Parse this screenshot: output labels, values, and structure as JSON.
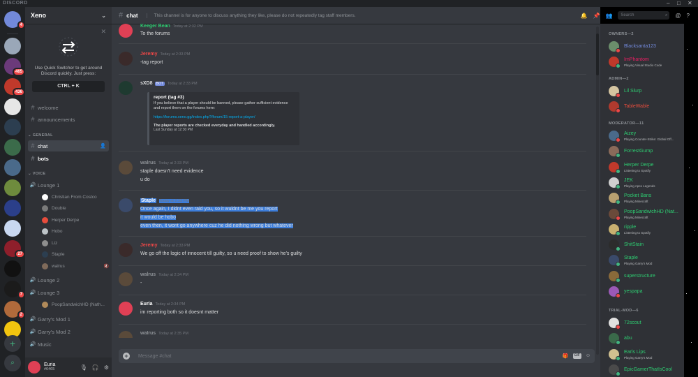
{
  "app": {
    "brand": "DISCORD"
  },
  "servers": [
    {
      "color": "#7289da",
      "badge": "4"
    },
    {
      "color": "#9aa7b8",
      "badge": ""
    },
    {
      "color": "#6b3a7a",
      "badge": "465"
    },
    {
      "color": "#c0392b",
      "badge": "436"
    },
    {
      "color": "#e6e6e6",
      "badge": ""
    },
    {
      "color": "#2c3e50",
      "badge": ""
    },
    {
      "color": "#3b6b4a",
      "badge": ""
    },
    {
      "color": "#4a6a8a",
      "badge": ""
    },
    {
      "color": "#6e8b3d",
      "badge": ""
    },
    {
      "color": "#2b3f8a",
      "badge": ""
    },
    {
      "color": "#c8d8f0",
      "badge": ""
    },
    {
      "color": "#8e1f2b",
      "badge": "27"
    },
    {
      "color": "#111111",
      "badge": ""
    },
    {
      "color": "#1b1b1b",
      "badge": "7"
    },
    {
      "color": "#b06a3b",
      "badge": "2"
    },
    {
      "color": "#f1c40f",
      "badge": ""
    }
  ],
  "guild": {
    "name": "Xeno"
  },
  "quick_switcher": {
    "text": "Use Quick Switcher to get around Discord quickly. Just press:",
    "key": "CTRL + K"
  },
  "channels_top": [
    {
      "name": "welcome"
    },
    {
      "name": "announcements"
    }
  ],
  "categories": {
    "general": "GENERAL",
    "voice": "VOICE"
  },
  "general_channels": [
    {
      "name": "chat"
    },
    {
      "name": "bots"
    }
  ],
  "voice": {
    "lounge1": "Lounge 1",
    "lounge1_users": [
      {
        "name": "Christian From Costco",
        "color": "#ffffff"
      },
      {
        "name": "Double",
        "color": "#7a7a7a"
      },
      {
        "name": "Herper Derpe",
        "color": "#e74c3c"
      },
      {
        "name": "Hobo",
        "color": "#bdc3c7"
      },
      {
        "name": "Liz",
        "color": "#8e8e8e"
      },
      {
        "name": "Staple",
        "color": "#2c3e50"
      },
      {
        "name": "walrus",
        "color": "#7f6a5a"
      }
    ],
    "lounge2": "Lounge 2",
    "lounge3": "Lounge 3",
    "lounge3_users": [
      {
        "name": "PoopSandwichHD (Nath...",
        "color": "#b08a5a"
      }
    ],
    "garrys1": "Garry's Mod 1",
    "garrys2": "Garry's Mod 2",
    "music": "Music"
  },
  "user_panel": {
    "name": "Euria",
    "tag": "#6465"
  },
  "header": {
    "channel": "chat",
    "topic": "This channel is for anyone to discuss anything they like, please do not repeatedly tag staff members.",
    "search_placeholder": "Search"
  },
  "messages": {
    "m1": {
      "author": "Keeger Bean",
      "time": "Today at 2:32 PM",
      "line": "To the forums",
      "color": "#2ecc71"
    },
    "m2": {
      "author": "Jeremy",
      "time": "Today at 2:33 PM",
      "line": "-tag report",
      "color": "#f04747"
    },
    "m3": {
      "author": "sXD8",
      "bot": "BOT",
      "time": "Today at 2:33 PM",
      "embed_title": "report (tag #3)",
      "embed_desc": "If you believe that a player should be banned, please gather sufficient evidence and report them on the forums here:",
      "embed_link": "https://forums.xeno.gg/index.php?/forum/15-report-a-player/",
      "embed_bold": "The player reports are checked everyday and handled accordingly.",
      "embed_footer": "Last Sunday at 12:30 PM"
    },
    "m4": {
      "author": "walrus",
      "time": "Today at 2:33 PM",
      "line1": "staple doesn't need evidence",
      "line2": "u do"
    },
    "m5": {
      "author": "Staple",
      "time": "Today at 2:33 PM",
      "line1": "Once again, I didnt even raid you, so it wuldnt be me you report",
      "line2": "it would be hobo",
      "line3": "even then, it wont go anywhere cuz he did nothing wrong but whatever"
    },
    "m6": {
      "author": "Jeremy",
      "time": "Today at 2:33 PM",
      "line": "We go off the logic of innocent till guilty, so u need proof to show he's guilty",
      "color": "#f04747"
    },
    "m7": {
      "author": "walrus",
      "time": "Today at 2:34 PM",
      "line": "-"
    },
    "m8": {
      "author": "Euria",
      "time": "Today at 2:34 PM",
      "line": "im reporting both so it doesnt matter"
    },
    "m9": {
      "author": "walrus",
      "time": "Today at 2:35 PM"
    }
  },
  "composer": {
    "placeholder": "Message #chat",
    "gif": "GIF"
  },
  "member_groups": {
    "owners": "OWNERS—2",
    "admin": "ADMIN—2",
    "moderator": "MODERATOR—11",
    "trialmod": "TRIAL-MOD—6"
  },
  "owners": [
    {
      "name": "Blacksanta123",
      "color": "#7289da",
      "avatar": "#6b8e6b",
      "status": "#f04747",
      "activity": ""
    },
    {
      "name": "ImPhantom",
      "color": "#e91e63",
      "avatar": "#c0392b",
      "status": "#43b581",
      "activity": "Playing Visual Studio Code"
    }
  ],
  "admins": [
    {
      "name": "Lil Slurp",
      "color": "#2ecc71",
      "avatar": "#d4c4a0",
      "status": "#f04747",
      "activity": ""
    },
    {
      "name": "TableWable",
      "color": "#e74c3c",
      "avatar": "#b03a2e",
      "status": "#f04747",
      "activity": ""
    }
  ],
  "moderators": [
    {
      "name": "Aizey",
      "color": "#2ecc71",
      "avatar": "#4a6a8a",
      "status": "#f04747",
      "activity": "Playing Counter-Strike: Global Off..."
    },
    {
      "name": "ForrestGump",
      "color": "#2ecc71",
      "avatar": "#8a6a5a",
      "status": "#43b581",
      "activity": ""
    },
    {
      "name": "Herper Derpe",
      "color": "#2ecc71",
      "avatar": "#c0392b",
      "status": "#43b581",
      "activity": "Listening to Spotify"
    },
    {
      "name": "JEK",
      "color": "#2ecc71",
      "avatar": "#d0d0d0",
      "status": "#43b581",
      "activity": "Playing Apex Legends"
    },
    {
      "name": "Pocket Bans",
      "color": "#2ecc71",
      "avatar": "#b8a070",
      "status": "#43b581",
      "activity": "Playing Minecraft"
    },
    {
      "name": "PoopSandwichHD (Nat...",
      "color": "#2ecc71",
      "avatar": "#6a4a3a",
      "status": "#f04747",
      "activity": "Playing Minecraft"
    },
    {
      "name": "ripple",
      "color": "#2ecc71",
      "avatar": "#c8b070",
      "status": "#43b581",
      "activity": "Listening to Spotify"
    },
    {
      "name": "ShitStain",
      "color": "#2ecc71",
      "avatar": "#2c2c2c",
      "status": "#43b581",
      "activity": ""
    },
    {
      "name": "Staple",
      "color": "#2ecc71",
      "avatar": "#3a4a6a",
      "status": "#43b581",
      "activity": "Playing Garry's Mod"
    },
    {
      "name": "superstructure",
      "color": "#2ecc71",
      "avatar": "#8a6a3a",
      "status": "#43b581",
      "activity": ""
    },
    {
      "name": "yespapa",
      "color": "#2ecc71",
      "avatar": "#9b59b6",
      "status": "#f04747",
      "activity": ""
    }
  ],
  "trialmods": [
    {
      "name": "72scout",
      "color": "#2ecc71",
      "avatar": "#e0e0e0",
      "status": "#f04747",
      "activity": ""
    },
    {
      "name": "abu",
      "color": "#2ecc71",
      "avatar": "#3a6a4a",
      "status": "#43b581",
      "activity": ""
    },
    {
      "name": "Earls Lips",
      "color": "#2ecc71",
      "avatar": "#d0c090",
      "status": "#43b581",
      "activity": "Playing Garry's Mod"
    },
    {
      "name": "EpicGamerThatIsCool",
      "color": "#2ecc71",
      "avatar": "#4a4a4a",
      "status": "#43b581",
      "activity": ""
    }
  ],
  "colors": {
    "accent": "#7289da",
    "online": "#43b581",
    "dnd": "#f04747",
    "selection": "#3d7edb"
  }
}
